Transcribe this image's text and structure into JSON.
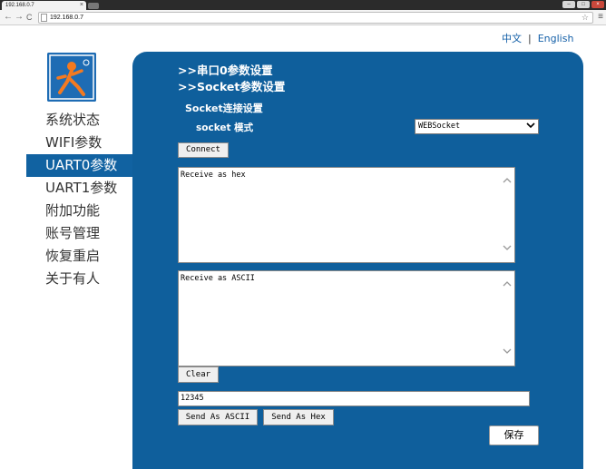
{
  "browser": {
    "tab_title": "192.168.0.7",
    "tab_close": "×",
    "url": "192.168.0.7",
    "back": "←",
    "forward": "→",
    "reload": "C",
    "star": "☆",
    "menu": "≡"
  },
  "lang": {
    "zh": "中文",
    "sep": "|",
    "en": "English"
  },
  "sidebar": {
    "items": [
      {
        "label": "系统状态"
      },
      {
        "label": "WIFI参数"
      },
      {
        "label": "UART0参数"
      },
      {
        "label": "UART1参数"
      },
      {
        "label": "附加功能"
      },
      {
        "label": "账号管理"
      },
      {
        "label": "恢复重启"
      },
      {
        "label": "关于有人"
      }
    ],
    "active_index": 2
  },
  "panel": {
    "title1": ">>串口0参数设置",
    "title2": ">>Socket参数设置",
    "subtitle": "Socket连接设置",
    "mode_label": "socket 模式",
    "mode_value": "WEBSocket",
    "connect": "Connect",
    "hex_text": "Receive as hex",
    "ascii_text": "Receive as ASCII",
    "clear": "Clear",
    "send_value": "12345",
    "send_ascii": "Send As ASCII",
    "send_hex": "Send As Hex",
    "save": "保存"
  },
  "colors": {
    "panel": "#0f5f9c",
    "active_nav": "#1162a1",
    "link": "#1560a8"
  }
}
